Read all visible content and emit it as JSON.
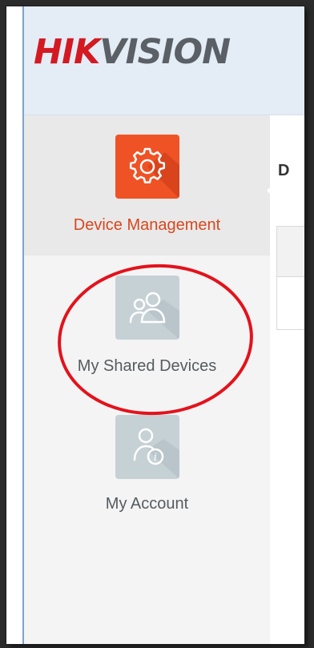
{
  "brand": {
    "logo_red": "HIK",
    "logo_gray": "VISION",
    "registered": "®"
  },
  "sidebar": {
    "items": [
      {
        "label": "Device Management",
        "icon": "gear-icon",
        "active": true
      },
      {
        "label": "My Shared Devices",
        "icon": "shared-users-icon",
        "active": false
      },
      {
        "label": "My Account",
        "icon": "account-info-icon",
        "active": false
      }
    ]
  },
  "content": {
    "title_partial": "D"
  },
  "colors": {
    "accent": "#ef5325",
    "active_text": "#d8471e",
    "inactive_icon_bg": "#c6d1d6",
    "header_bg": "#e4edf6",
    "annotation": "#e3121c"
  }
}
